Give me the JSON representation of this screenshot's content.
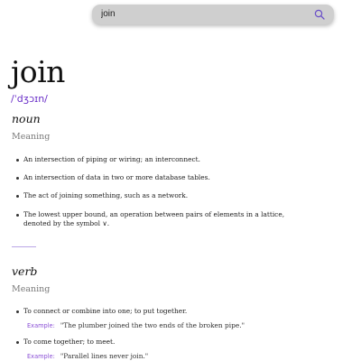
{
  "search": {
    "value": "join",
    "placeholder": ""
  },
  "entry": {
    "word": "join",
    "phonetic": "/ˈdʒɔɪn/"
  },
  "sections": [
    {
      "part_of_speech": "noun",
      "meaning_label": "Meaning",
      "definitions": [
        {
          "text": "An intersection of piping or wiring; an interconnect."
        },
        {
          "text": "An intersection of data in two or more database tables."
        },
        {
          "text": "The act of joining something, such as a network."
        },
        {
          "text": "The lowest upper bound, an operation between pairs of elements in a lattice, denoted by the symbol ∨."
        }
      ]
    },
    {
      "part_of_speech": "verb",
      "meaning_label": "Meaning",
      "definitions": [
        {
          "text": "To connect or combine into one; to put together.",
          "example_label": "Example:",
          "example": "\"The plumber joined the two ends of the broken pipe.\""
        },
        {
          "text": "To come together; to meet.",
          "example_label": "Example:",
          "example": "\"Parallel lines never join.\""
        }
      ]
    }
  ],
  "colors": {
    "accent": "#6a2fc8",
    "example_label": "#8a4fd6",
    "search_bg": "#cfcfcf"
  },
  "icons": {
    "search": "search-icon"
  }
}
